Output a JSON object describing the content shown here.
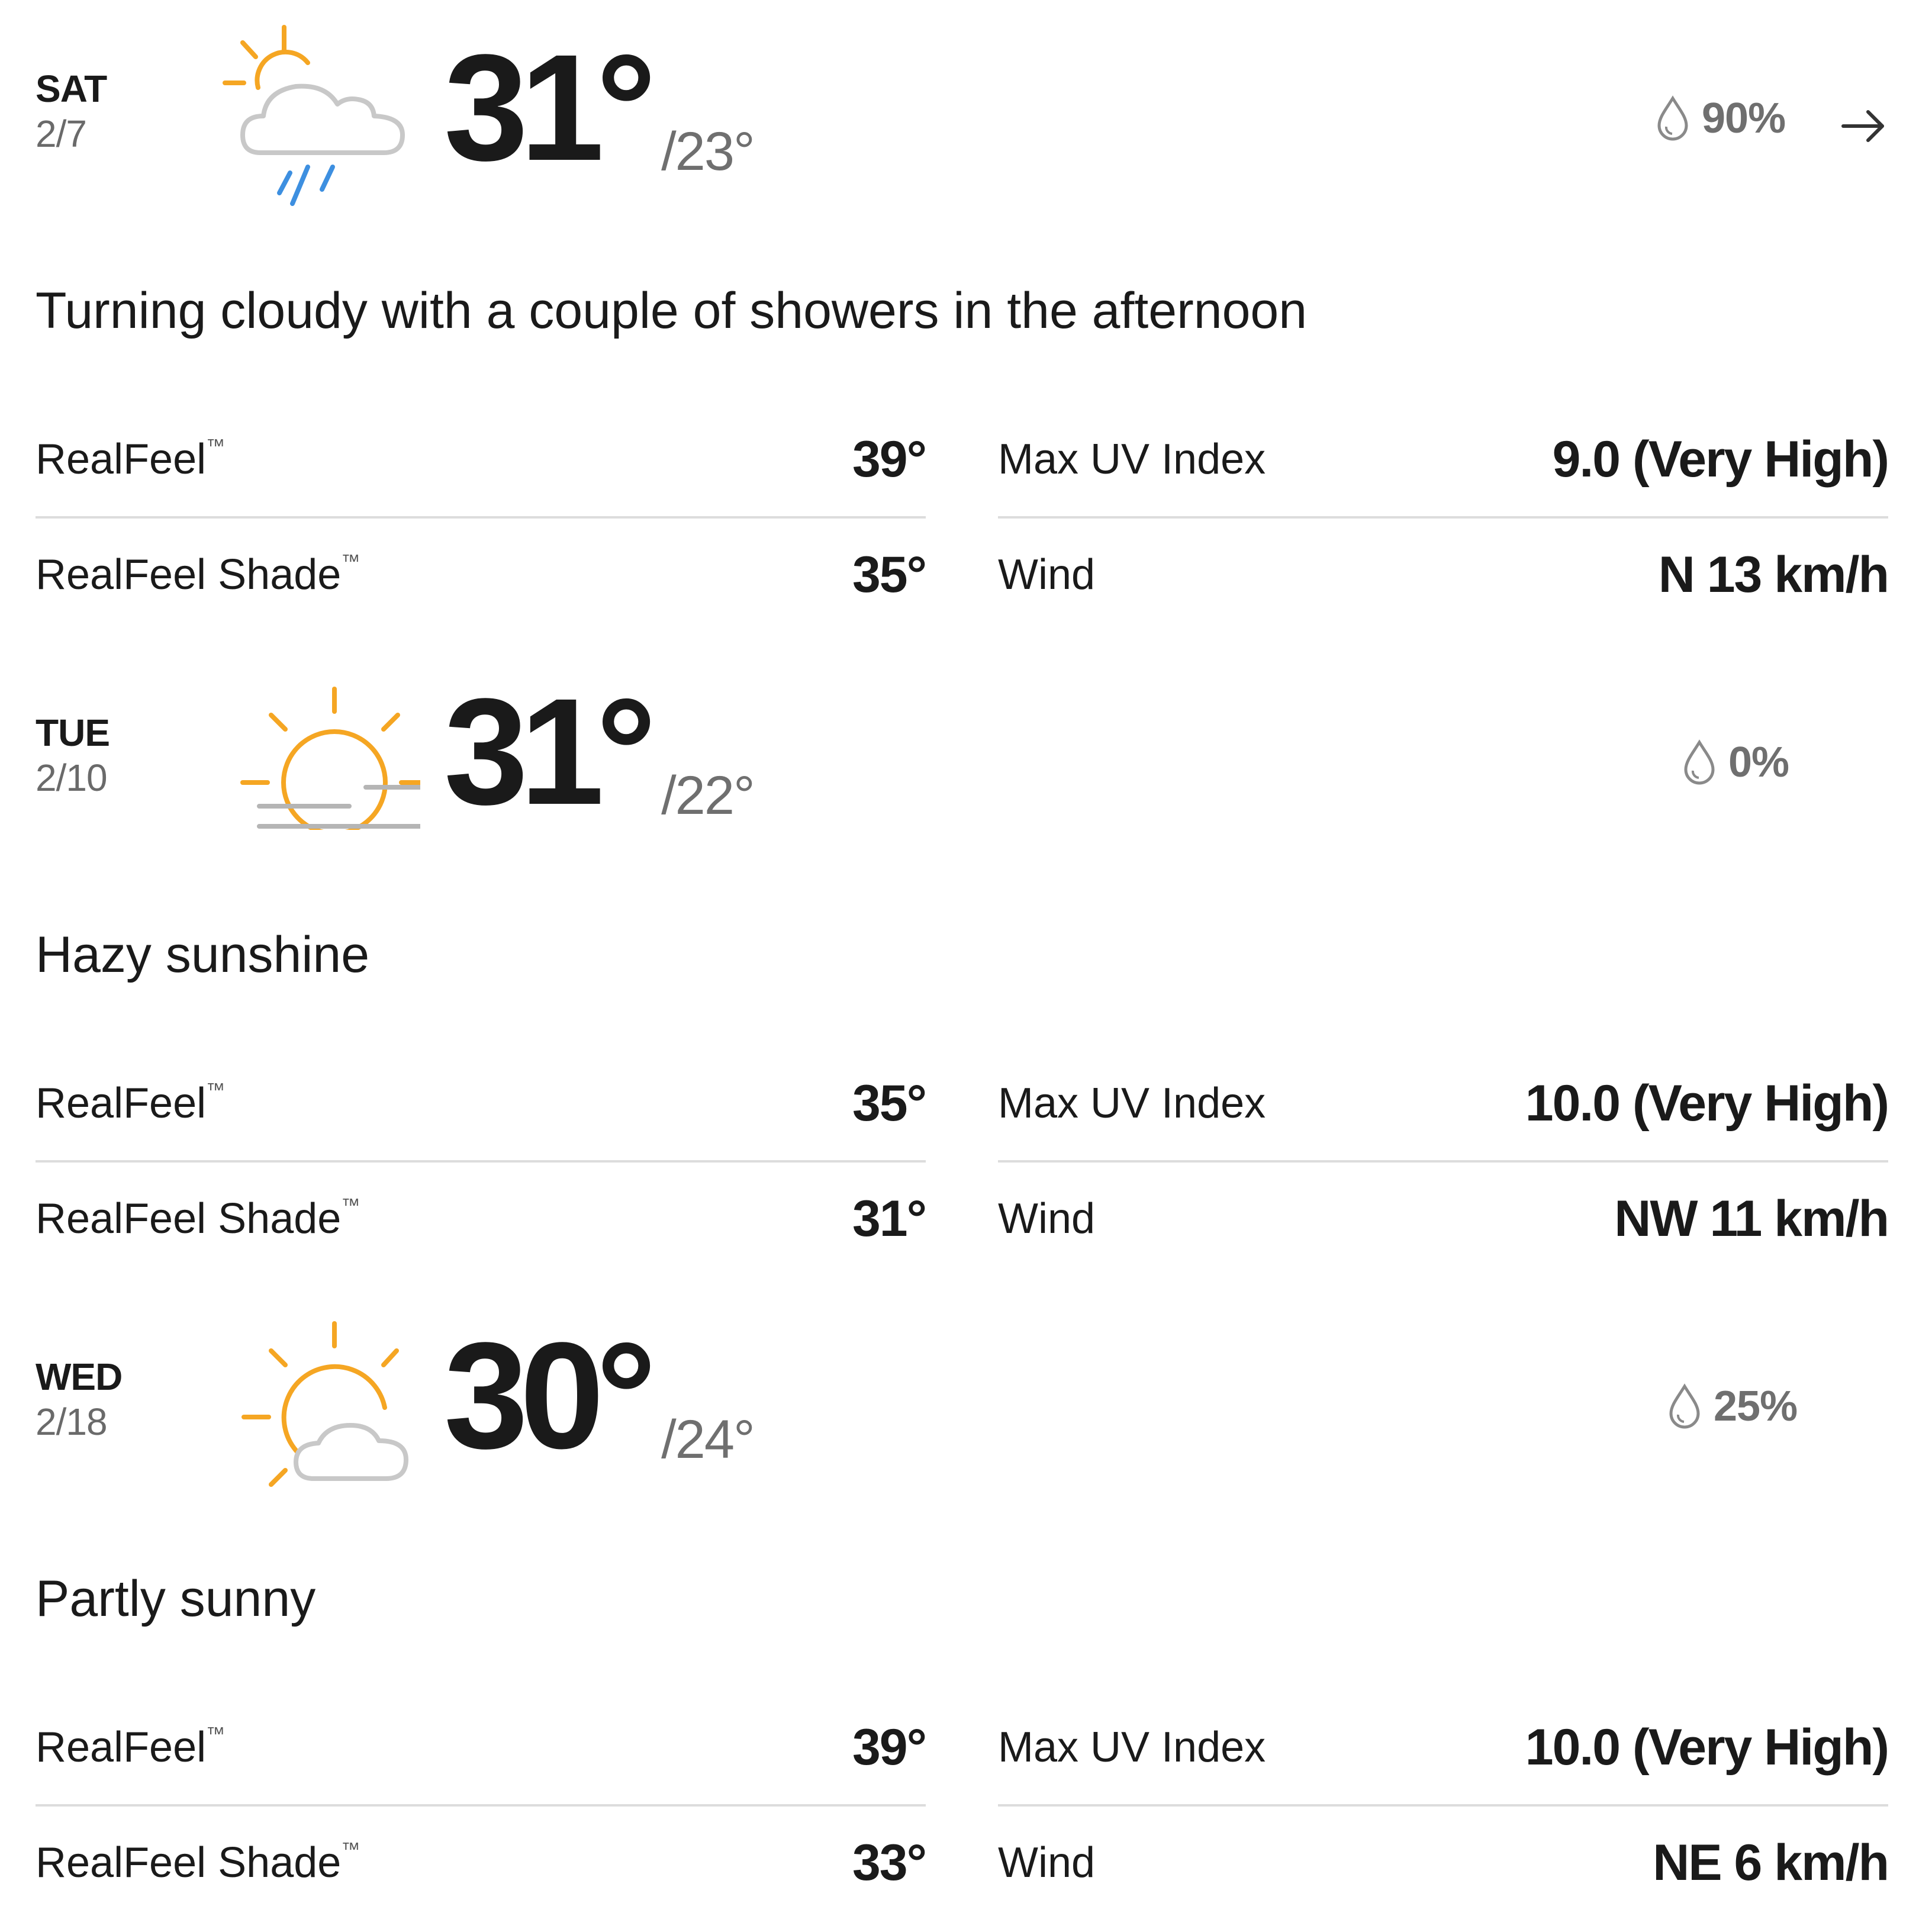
{
  "forecast": [
    {
      "day": "SAT",
      "date": "2/7",
      "icon": "sun-cloud-rain-icon",
      "high": "31°",
      "low": "/23°",
      "precip": "90%",
      "phrase": "Turning cloudy with a couple of showers in the afternoon",
      "realfeel_label": "RealFeel",
      "realfeel": "39°",
      "realfeel_shade_label": "RealFeel Shade",
      "realfeel_shade": "35°",
      "uv_label": "Max UV Index",
      "uv": "9.0 (Very High)",
      "wind_label": "Wind",
      "wind": "N 13 km/h"
    },
    {
      "day": "TUE",
      "date": "2/10",
      "icon": "hazy-sun-icon",
      "high": "31°",
      "low": "/22°",
      "precip": "0%",
      "phrase": "Hazy sunshine",
      "realfeel_label": "RealFeel",
      "realfeel": "35°",
      "realfeel_shade_label": "RealFeel Shade",
      "realfeel_shade": "31°",
      "uv_label": "Max UV Index",
      "uv": "10.0 (Very High)",
      "wind_label": "Wind",
      "wind": "NW 11 km/h"
    },
    {
      "day": "WED",
      "date": "2/18",
      "icon": "partly-sunny-icon",
      "high": "30°",
      "low": "/24°",
      "precip": "25%",
      "phrase": "Partly sunny",
      "realfeel_label": "RealFeel",
      "realfeel": "39°",
      "realfeel_shade_label": "RealFeel Shade",
      "realfeel_shade": "33°",
      "uv_label": "Max UV Index",
      "uv": "10.0 (Very High)",
      "wind_label": "Wind",
      "wind": "NE 6 km/h"
    }
  ],
  "trademark_mark": "™",
  "colors": {
    "sun": "#f5a623",
    "cloud": "#c8c8c8",
    "rain": "#3d8fe0",
    "haze": "#b5b5b5",
    "muted_text": "#6f6f6f",
    "divider": "#dcdcdc"
  }
}
